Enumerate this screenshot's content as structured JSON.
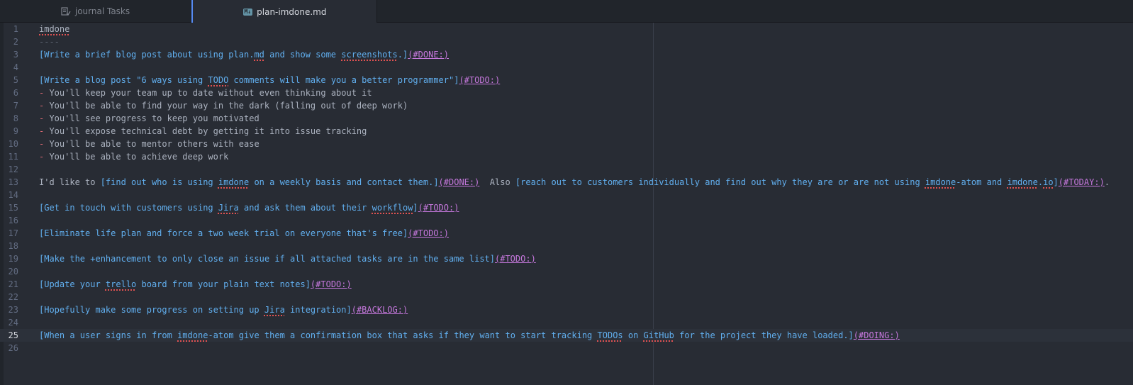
{
  "tabs": [
    {
      "label": "journal Tasks",
      "icon": "checklist-icon",
      "active": false
    },
    {
      "label": "plan-imdone.md",
      "icon": "markdown-icon",
      "icon_text": "M↓",
      "active": true
    }
  ],
  "colors": {
    "background": "#282c34",
    "link": "#61afef",
    "tag": "#c678dd",
    "gutter": "#636d83",
    "active_tab_accent": "#568af2",
    "spell_error": "#e05252"
  },
  "editor": {
    "cursor_line": 25,
    "lines": [
      {
        "n": "1",
        "text": "imdone"
      },
      {
        "n": "2",
        "text": "----"
      },
      {
        "n": "3",
        "text": "[Write a brief blog post about using plan.md and show some screenshots.](#DONE:)"
      },
      {
        "n": "4",
        "text": ""
      },
      {
        "n": "5",
        "text": "[Write a blog post \"6 ways using TODO comments will make you a better programmer\"](#TODO:)"
      },
      {
        "n": "6",
        "text": "- You'll keep your team up to date without even thinking about it"
      },
      {
        "n": "7",
        "text": "- You'll be able to find your way in the dark (falling out of deep work)"
      },
      {
        "n": "8",
        "text": "- You'll see progress to keep you motivated"
      },
      {
        "n": "9",
        "text": "- You'll expose technical debt by getting it into issue tracking"
      },
      {
        "n": "10",
        "text": "- You'll be able to mentor others with ease"
      },
      {
        "n": "11",
        "text": "- You'll be able to achieve deep work"
      },
      {
        "n": "12",
        "text": ""
      },
      {
        "n": "13",
        "text": "I'd like to [find out who is using imdone on a weekly basis and contact them.](#DONE:)  Also [reach out to customers individually and find out why they are or are not using imdone-atom and imdone.io](#TODAY:)."
      },
      {
        "n": "14",
        "text": ""
      },
      {
        "n": "15",
        "text": "[Get in touch with customers using Jira and ask them about their workflow](#TODO:)"
      },
      {
        "n": "16",
        "text": ""
      },
      {
        "n": "17",
        "text": "[Eliminate life plan and force a two week trial on everyone that's free](#TODO:)"
      },
      {
        "n": "18",
        "text": ""
      },
      {
        "n": "19",
        "text": "[Make the +enhancement to only close an issue if all attached tasks are in the same list](#TODO:)"
      },
      {
        "n": "20",
        "text": ""
      },
      {
        "n": "21",
        "text": "[Update your trello board from your plain text notes](#TODO:)"
      },
      {
        "n": "22",
        "text": ""
      },
      {
        "n": "23",
        "text": "[Hopefully make some progress on setting up Jira integration](#BACKLOG:)"
      },
      {
        "n": "24",
        "text": ""
      },
      {
        "n": "25",
        "text": "[When a user signs in from imdone-atom give them a confirmation box that asks if they want to start tracking TODOs on GitHub for the project they have loaded.](#DOING:)"
      },
      {
        "n": "26",
        "text": ""
      }
    ]
  }
}
